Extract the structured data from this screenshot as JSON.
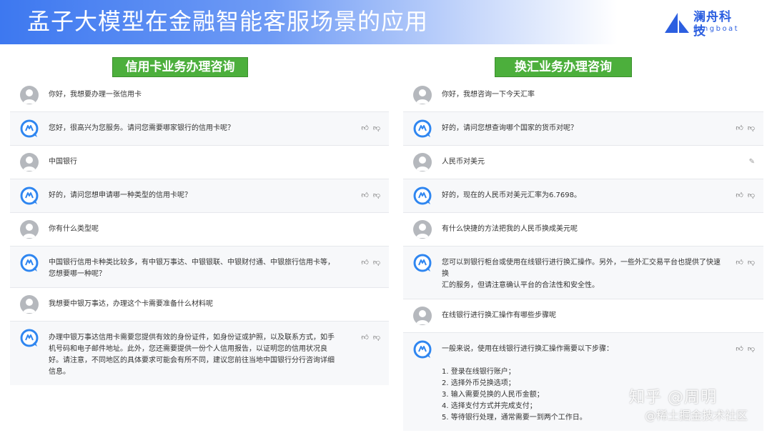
{
  "header": {
    "title": "孟子大模型在金融智能客服场景的应用",
    "logo_cn": "澜舟科技",
    "logo_en": "langboat"
  },
  "colors": {
    "accent": "#3d78f0",
    "panel_title_bg": "#4caf3c",
    "bot_bg": "#f7f8fa"
  },
  "icons": {
    "user": "user-avatar-icon",
    "bot": "bot-avatar-icon",
    "like": "thumbs-up-icon",
    "dislike": "thumbs-down-icon",
    "edit": "edit-icon"
  },
  "left_panel": {
    "title": "信用卡业务办理咨询",
    "messages": [
      {
        "role": "user",
        "text": "你好，我想要办理一张信用卡"
      },
      {
        "role": "bot",
        "text": "您好，很高兴为您服务。请问您需要哪家银行的信用卡呢？"
      },
      {
        "role": "user",
        "text": "中国银行"
      },
      {
        "role": "bot",
        "text": "好的，请问您想申请哪一种类型的信用卡呢？"
      },
      {
        "role": "user",
        "text": "你有什么类型呢"
      },
      {
        "role": "bot",
        "text": "中国银行信用卡种类比较多，有中银万事达、中银银联、中银财付通、中银旅行信用卡等，\n您想要哪一种呢？"
      },
      {
        "role": "user",
        "text": "我想要中银万事达，办理这个卡需要准备什么材料呢"
      },
      {
        "role": "bot",
        "text": "办理中银万事达信用卡需要您提供有效的身份证件，如身份证或护照，以及联系方式，如手\n机号码和电子邮件地址。此外，您还需要提供一份个人信用报告，以证明您的信用状况良\n好。请注意，不同地区的具体要求可能会有所不同，建议您前往当地中国银行分行咨询详细\n信息。"
      }
    ]
  },
  "right_panel": {
    "title": "换汇业务办理咨询",
    "messages": [
      {
        "role": "user",
        "text": "你好，我想咨询一下今天汇率"
      },
      {
        "role": "bot",
        "text": "好的，请问您想查询哪个国家的货币对呢？"
      },
      {
        "role": "user",
        "text": "人民币对美元",
        "editable": true
      },
      {
        "role": "bot",
        "text": "好的，现在的人民币对美元汇率为6.7698。"
      },
      {
        "role": "user",
        "text": "有什么快捷的方法把我的人民币换成美元呢"
      },
      {
        "role": "bot",
        "text": "您可以到银行柜台或使用在线银行进行换汇操作。另外，一些外汇交易平台也提供了快速换\n汇的服务，但请注意确认平台的合法性和安全性。"
      },
      {
        "role": "user",
        "text": "在线银行进行换汇操作有哪些步骤呢"
      },
      {
        "role": "bot",
        "text": "一般来说，使用在线银行进行换汇操作需要以下步骤：\n\n1. 登录在线银行账户；\n2. 选择外币兑换选项；\n3. 输入需要兑换的人民币金额；\n4. 选择支付方式并完成支付；\n5. 等待银行处理，通常需要一到两个工作日。"
      }
    ]
  },
  "watermark": {
    "line1": "知乎 @周明",
    "line2": "@稀土掘金技术社区"
  }
}
